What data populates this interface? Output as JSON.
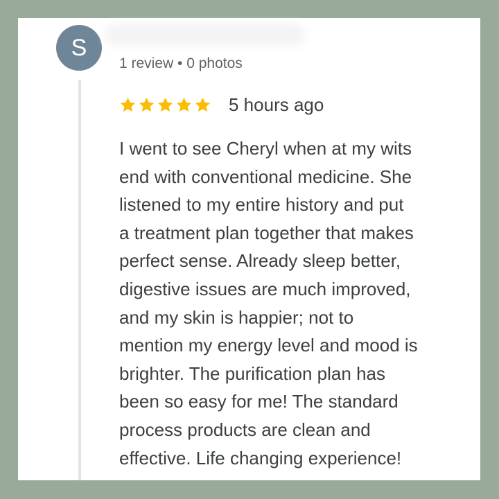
{
  "review": {
    "avatar_initial": "S",
    "meta": "1 review • 0 photos",
    "rating": 5,
    "rating_max": 5,
    "time_ago": "5 hours ago",
    "text": "I went to see Cheryl when at my wits\nend with conventional medicine. She\nlistened to my entire history and put\na treatment plan together that makes\nperfect sense. Already sleep better,\ndigestive issues are much improved,\nand my skin is happier; not to\nmention my energy level and mood is\nbrighter. The purification plan has\nbeen so easy for me! The standard\nprocess products are clean and\neffective. Life changing experience!"
  },
  "colors": {
    "frame_background": "#9aaa9a",
    "avatar_background": "#6f8699",
    "star_color": "#fbbc04",
    "text_color": "#3c4043",
    "meta_color": "#5f6368"
  },
  "icons": {
    "star": "star-icon"
  }
}
